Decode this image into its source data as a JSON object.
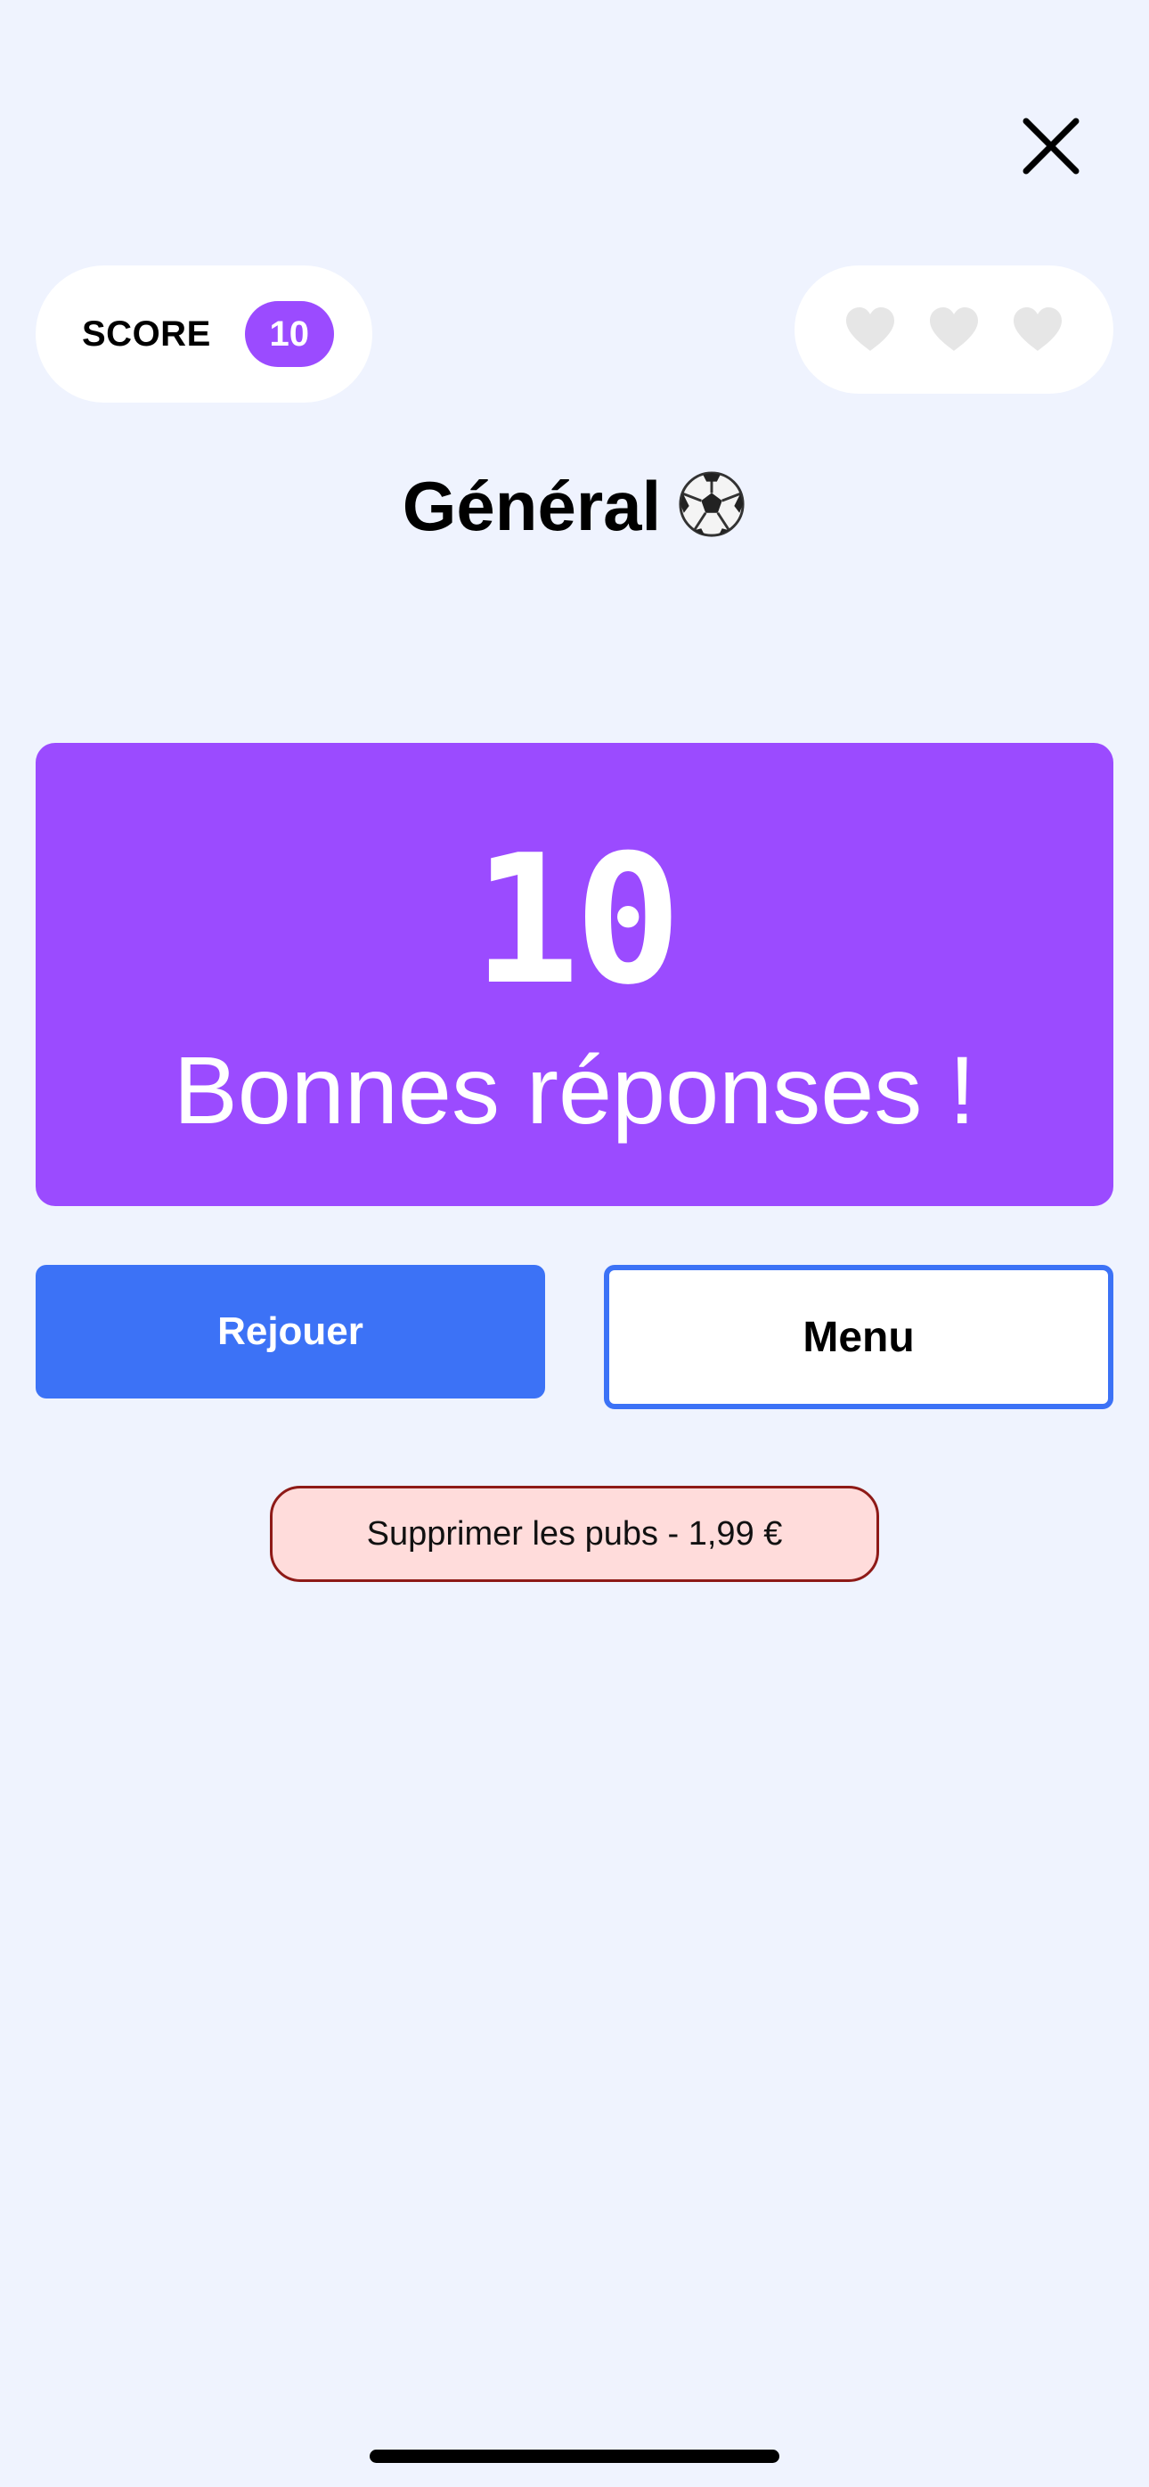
{
  "header": {
    "close_icon": "close-icon",
    "score_label": "SCORE",
    "score_value": "10",
    "lives": [
      "heart-icon",
      "heart-icon",
      "heart-icon"
    ],
    "lives_color": "#e6e6e6"
  },
  "category": {
    "title": "Général",
    "icon": "soccer-ball-icon"
  },
  "result": {
    "count": "10",
    "message": "Bonnes réponses !"
  },
  "actions": {
    "replay_label": "Rejouer",
    "menu_label": "Menu"
  },
  "remove_ads": {
    "label": "Supprimer les pubs - 1,99 €"
  },
  "colors": {
    "background": "#eff3fe",
    "accent_purple": "#9b4bff",
    "primary_blue": "#3c72f6",
    "ads_background": "#ffdcdb",
    "ads_border": "#8e1a17"
  }
}
